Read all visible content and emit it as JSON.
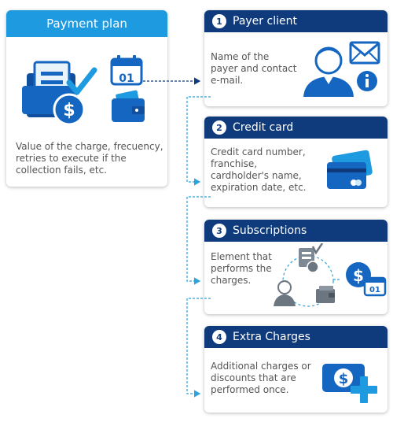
{
  "payment_plan": {
    "title": "Payment plan",
    "calendar_day": "01",
    "description": "Value of the charge, frecuency, retries to execute if the collection fails, etc."
  },
  "steps": [
    {
      "number": "1",
      "title": "Payer client",
      "text": "Name of the payer and contact e-mail.",
      "icon_names": [
        "user-icon",
        "mail-icon",
        "info-icon"
      ]
    },
    {
      "number": "2",
      "title": "Credit card",
      "text": "Credit card number, franchise, cardholder's name, expiration date, etc.",
      "icon_names": [
        "credit-card-icon"
      ]
    },
    {
      "number": "3",
      "title": "Subscriptions",
      "text": "Element that performs the charges.",
      "calendar_day": "01",
      "icon_names": [
        "document-money-icon",
        "user-icon",
        "wallet-icon",
        "money-calendar-icon"
      ]
    },
    {
      "number": "4",
      "title": "Extra Charges",
      "text": "Additional charges or discounts that are performed once.",
      "icon_names": [
        "money-plus-icon"
      ]
    }
  ],
  "colors": {
    "light_header": "#1e9ae0",
    "dark_header": "#0f3b7c",
    "icon_blue": "#1566c0",
    "connector": "#2aa3de"
  }
}
